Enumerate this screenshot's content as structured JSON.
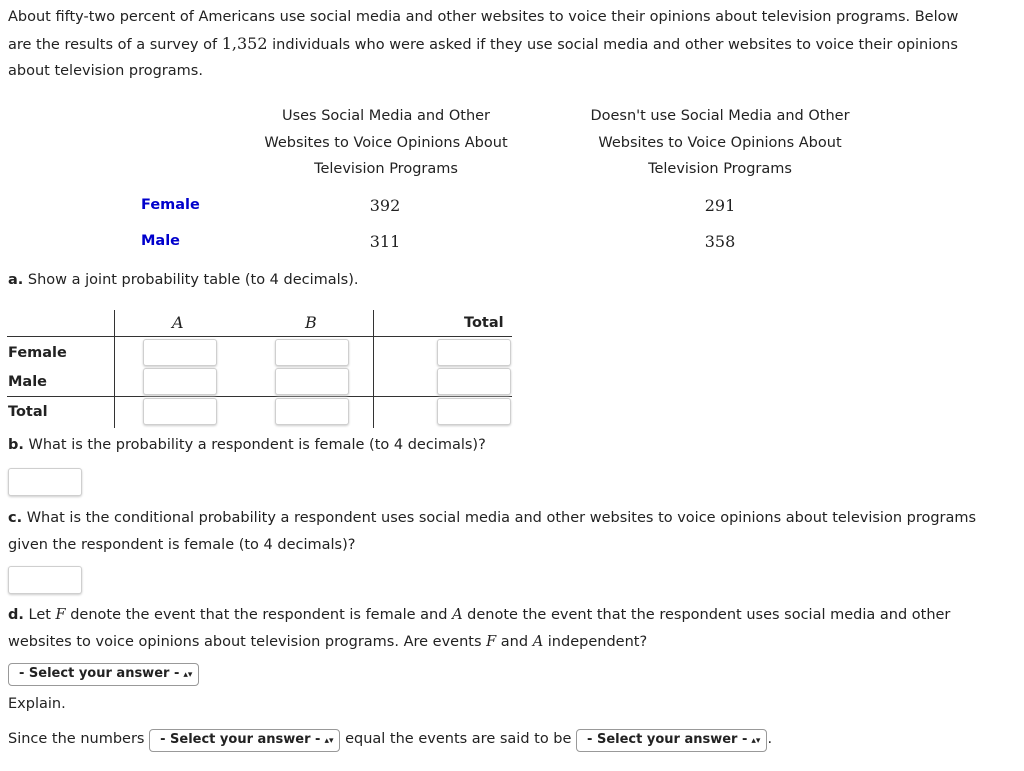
{
  "intro": {
    "line1": "About fifty-two percent of Americans use social media and other websites to voice their opinions about television programs. Below",
    "line2a": "are the results of a survey of ",
    "n": "1,352",
    "line2b": " individuals who were asked if they use social media and other websites to voice their opinions",
    "line3": "about television programs."
  },
  "survey": {
    "col1": [
      "Uses Social Media and Other",
      "Websites to Voice Opinions About",
      "Television Programs"
    ],
    "col2": [
      "Doesn't use Social Media and Other",
      "Websites to Voice Opinions About",
      "Television Programs"
    ],
    "rows": [
      {
        "label": "Female",
        "uses": "392",
        "not": "291"
      },
      {
        "label": "Male",
        "uses": "311",
        "not": "358"
      }
    ]
  },
  "qa": {
    "letter": "a.",
    "text": " Show a joint probability table (to 4 decimals)."
  },
  "joint": {
    "cols": [
      "A",
      "B",
      "Total"
    ],
    "rows": [
      "Female",
      "Male",
      "Total"
    ]
  },
  "qb": {
    "letter": "b.",
    "text": " What is the probability a respondent is female (to 4 decimals)?"
  },
  "qc": {
    "letter": "c.",
    "line1": " What is the conditional probability a respondent uses social media and other websites to voice opinions about television programs",
    "line2": "given the respondent is female (to 4 decimals)?"
  },
  "qd": {
    "letter": "d.",
    "p1": " Let ",
    "F": "F",
    "p2": " denote the event that the respondent is female and ",
    "A": "A",
    "p3": " denote the event that the respondent uses social media and other",
    "p4": "websites to voice opinions about television programs. Are events ",
    "p5": " and ",
    "p6": " independent?"
  },
  "select_label": "- Select your answer -",
  "explain": "Explain.",
  "since": {
    "a": "Since the numbers ",
    "b": " equal the events are said to be ",
    "c": "."
  }
}
